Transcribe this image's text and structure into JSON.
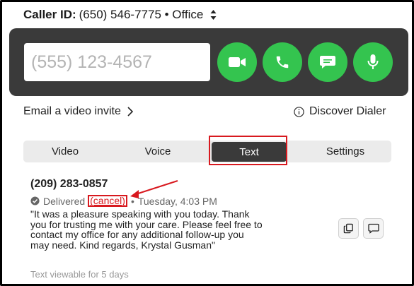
{
  "caller_id": {
    "label": "Caller ID:",
    "value": "(650) 546-7775 • Office"
  },
  "dialer": {
    "placeholder": "(555) 123-4567",
    "buttons": [
      "video-call",
      "voice-call",
      "text-message",
      "microphone"
    ],
    "accent_color": "#34c44f",
    "panel_color": "#3a3a3a"
  },
  "links": {
    "email_invite": "Email a video invite",
    "discover": "Discover Dialer"
  },
  "tabs": [
    {
      "label": "Video",
      "active": false
    },
    {
      "label": "Voice",
      "active": false
    },
    {
      "label": "Text",
      "active": true
    },
    {
      "label": "Settings",
      "active": false
    }
  ],
  "message": {
    "number": "(209) 283-0857",
    "status": "Delivered",
    "cancel": "(cancel)",
    "separator": "•",
    "timestamp": "Tuesday, 4:03 PM",
    "body": "\"It was a pleasure speaking with you today. Thank you for trusting me with your care. Please feel free to contact my office for any additional follow-up you may need. Kind regards, Krystal Gusman\"",
    "viewable": "Text viewable for 5 days"
  },
  "annotation_color": "#d8191f"
}
